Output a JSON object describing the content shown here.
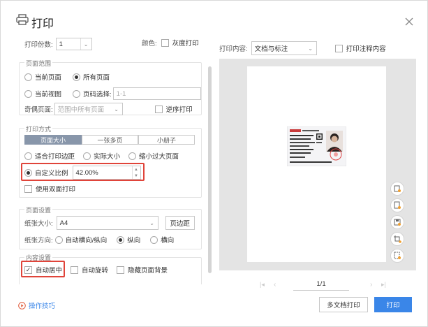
{
  "window": {
    "title": "打印"
  },
  "copies": {
    "label": "打印份数:",
    "value": "1"
  },
  "color": {
    "label": "颜色:",
    "grayscale_label": "灰度打印"
  },
  "page_range": {
    "title": "页面范围",
    "current_page": "当前页面",
    "all_pages": "所有页面",
    "current_view": "当前视图",
    "page_select": "页码选择:",
    "page_select_placeholder": "1-1",
    "odd_even_label": "奇偶页面:",
    "odd_even_value": "范围中所有页面",
    "reverse_label": "逆序打印"
  },
  "print_mode": {
    "title": "打印方式",
    "tabs": [
      "页面大小",
      "一张多页",
      "小册子"
    ],
    "fit_margin": "适合打印边距",
    "actual_size": "实际大小",
    "shrink_large": "缩小过大页面",
    "custom_scale": "自定义比例",
    "scale_value": "42.00%",
    "duplex": "使用双面打印"
  },
  "page_setup": {
    "title": "页面设置",
    "paper_size_label": "纸张大小:",
    "paper_size_value": "A4",
    "margins_button": "页边距",
    "orientation_label": "纸张方向:",
    "auto": "自动横向/纵向",
    "portrait": "纵向",
    "landscape": "横向"
  },
  "content_settings": {
    "title": "内容设置",
    "auto_center": "自动居中",
    "auto_rotate": "自动旋转",
    "hide_background": "隐藏页面背景"
  },
  "preview": {
    "content_label": "打印内容:",
    "content_value": "文档与标注",
    "annotation_label": "打印注释内容",
    "page_indicator": "1/1"
  },
  "footer": {
    "help_label": "操作技巧",
    "multi_print_button": "多文档打印",
    "print_button": "打印"
  },
  "colors": {
    "accent": "#3a86e8",
    "highlight": "#e0443a",
    "segment_active": "#8896aa"
  }
}
